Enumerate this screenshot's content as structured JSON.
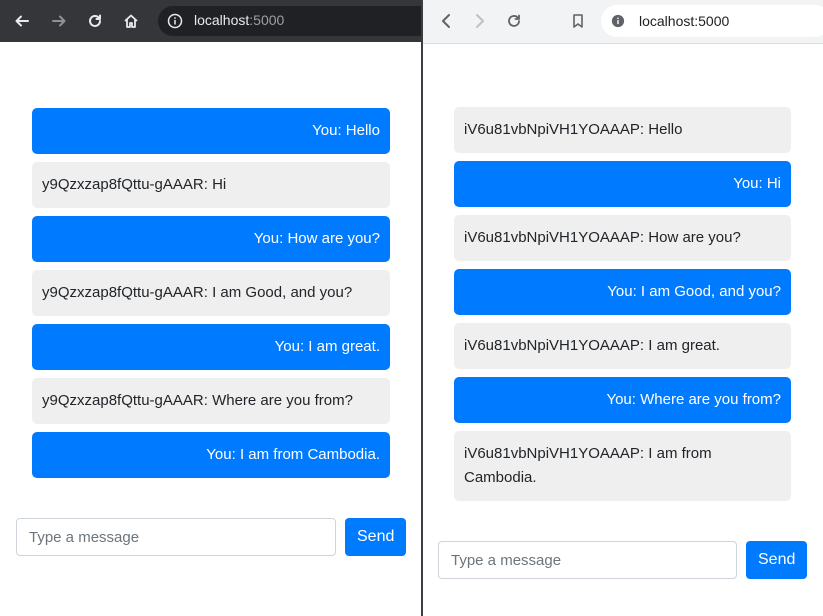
{
  "left_window": {
    "address": {
      "host": "localhost",
      "port": ":5000"
    },
    "messages": [
      {
        "from": "me",
        "text": "You: Hello"
      },
      {
        "from": "other",
        "text": "y9Qzxzap8fQttu-gAAAR: Hi"
      },
      {
        "from": "me",
        "text": "You: How are you?"
      },
      {
        "from": "other",
        "text": "y9Qzxzap8fQttu-gAAAR: I am Good, and you?"
      },
      {
        "from": "me",
        "text": "You: I am great."
      },
      {
        "from": "other",
        "text": "y9Qzxzap8fQttu-gAAAR: Where are you from?"
      },
      {
        "from": "me",
        "text": "You: I am from Cambodia."
      }
    ],
    "composer": {
      "placeholder": "Type a message",
      "send_label": "Send"
    },
    "colors": {
      "bar": "#35363a",
      "accent": "#007bff"
    }
  },
  "right_window": {
    "address": {
      "host": "localhost:5000"
    },
    "messages": [
      {
        "from": "other",
        "text": "iV6u81vbNpiVH1YOAAAP: Hello"
      },
      {
        "from": "me",
        "text": "You: Hi"
      },
      {
        "from": "other",
        "text": "iV6u81vbNpiVH1YOAAAP: How are you?"
      },
      {
        "from": "me",
        "text": "You: I am Good, and you?"
      },
      {
        "from": "other",
        "text": "iV6u81vbNpiVH1YOAAAP: I am great."
      },
      {
        "from": "me",
        "text": "You: Where are you from?"
      },
      {
        "from": "other",
        "text": "iV6u81vbNpiVH1YOAAAP: I am from Cambodia."
      }
    ],
    "composer": {
      "placeholder": "Type a message",
      "send_label": "Send"
    },
    "colors": {
      "bar": "#f1f3f4",
      "accent": "#007bff"
    }
  }
}
